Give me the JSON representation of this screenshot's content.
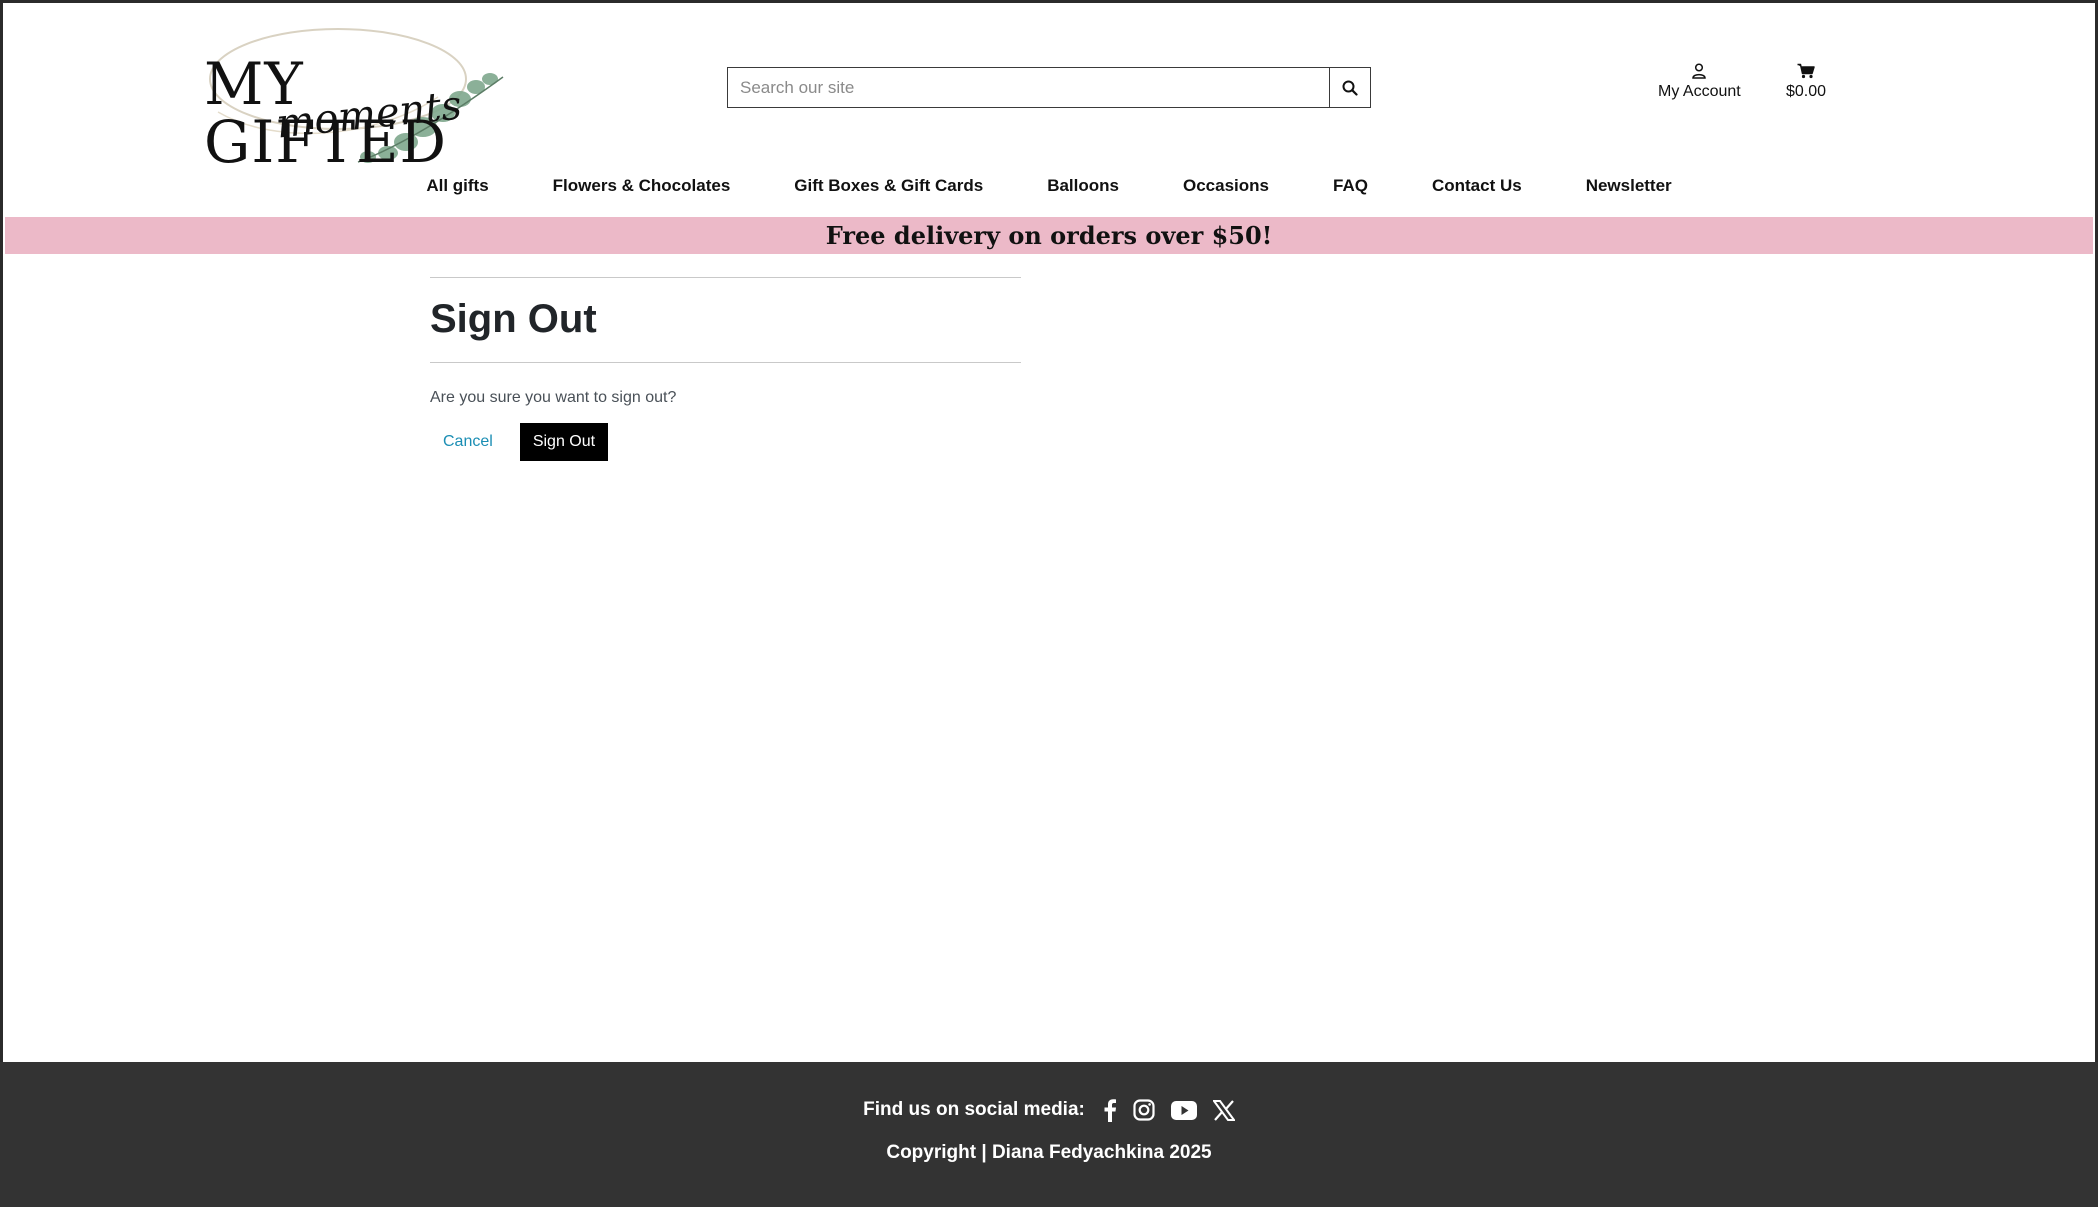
{
  "header": {
    "logo": {
      "line1": "MY GIFTED",
      "line2": "moments"
    },
    "search": {
      "placeholder": "Search our site",
      "value": ""
    },
    "account_label": "My Account",
    "cart_total": "$0.00"
  },
  "nav": {
    "items": [
      {
        "label": "All gifts"
      },
      {
        "label": "Flowers & Chocolates"
      },
      {
        "label": "Gift Boxes & Gift Cards"
      },
      {
        "label": "Balloons"
      },
      {
        "label": "Occasions"
      },
      {
        "label": "FAQ"
      },
      {
        "label": "Contact Us"
      },
      {
        "label": "Newsletter"
      }
    ]
  },
  "banner": {
    "text": "Free delivery on orders over $50!",
    "color": "#ecb9c8"
  },
  "main": {
    "title": "Sign Out",
    "question": "Are you sure you want to sign out?",
    "cancel_label": "Cancel",
    "signout_label": "Sign Out"
  },
  "footer": {
    "social_label": "Find us on social media:",
    "social_icons": [
      "facebook-icon",
      "instagram-icon",
      "youtube-icon",
      "x-icon"
    ],
    "copyright": "Copyright | Diana Fedyachkina 2025",
    "background": "#333333"
  },
  "colors": {
    "link": "#1b8eb4",
    "button": "#000000"
  }
}
